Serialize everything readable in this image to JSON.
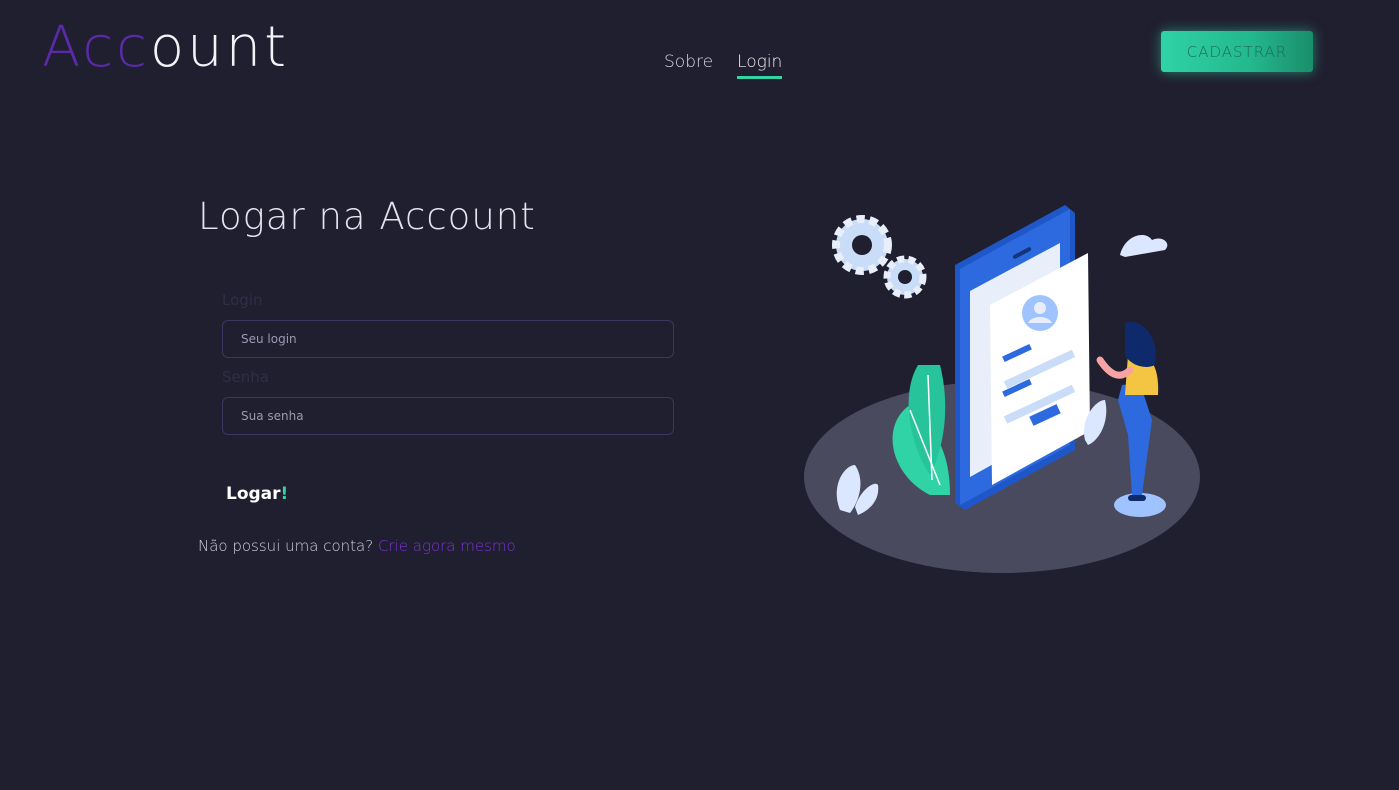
{
  "header": {
    "logo_accent": "Acc",
    "logo_rest": "ount",
    "nav": [
      {
        "label": "Sobre",
        "active": false
      },
      {
        "label": "Login",
        "active": true
      }
    ],
    "signup_label": "CADASTRAR"
  },
  "form": {
    "title": "Logar na Account",
    "login_label": "Login",
    "login_placeholder": "Seu login",
    "password_label": "Senha",
    "password_placeholder": "Sua senha",
    "submit_label": "Logar",
    "submit_suffix": "!",
    "no_account_text": "Não possui uma conta? ",
    "create_link": "Crie agora mesmo"
  },
  "colors": {
    "background": "#201f2f",
    "accent_green": "#2fd3a6",
    "accent_purple": "#7a34d0"
  },
  "icons": [
    "login-illustration"
  ]
}
